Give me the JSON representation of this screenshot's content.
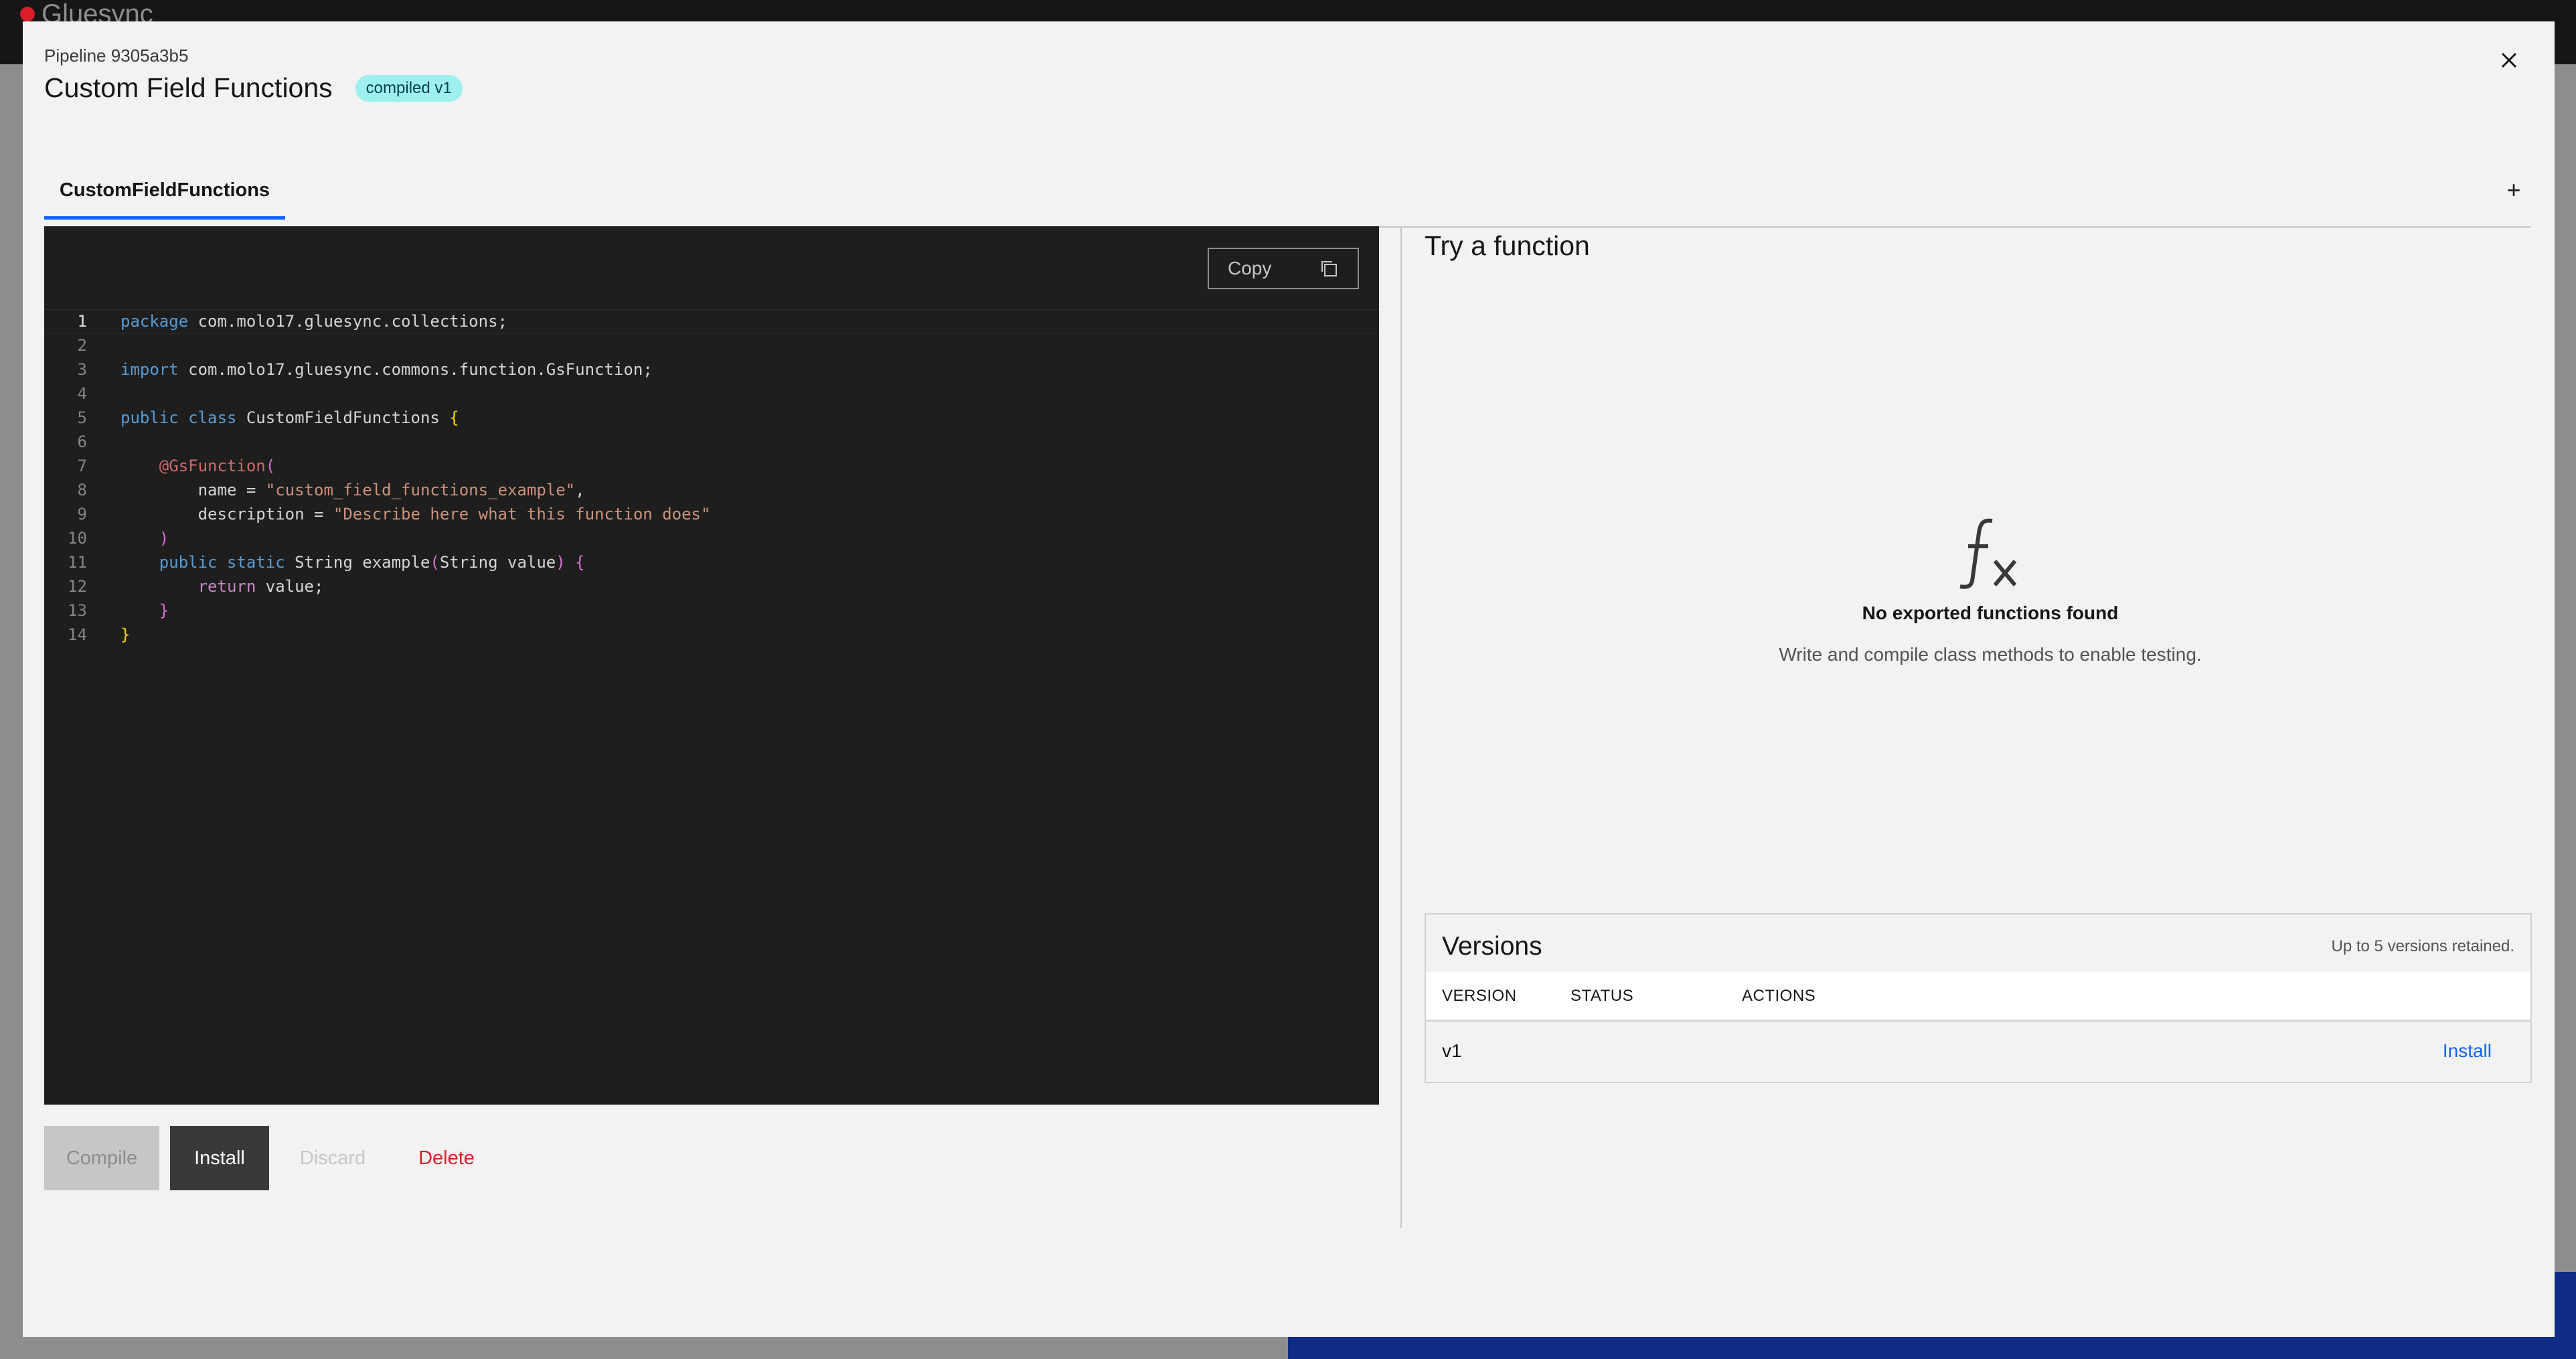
{
  "background": {
    "app_name": "Gluesync"
  },
  "modal": {
    "label": "Pipeline 9305a3b5",
    "title": "Custom Field Functions",
    "badge": "compiled v1"
  },
  "tabs": [
    {
      "label": "CustomFieldFunctions",
      "active": true
    }
  ],
  "add_tab_label": "+",
  "editor": {
    "copy_label": "Copy",
    "active_line": 1,
    "line_numbers": [
      "1",
      "2",
      "3",
      "4",
      "5",
      "6",
      "7",
      "8",
      "9",
      "10",
      "11",
      "12",
      "13",
      "14"
    ]
  },
  "actions": {
    "compile": "Compile",
    "install": "Install",
    "discard": "Discard",
    "delete": "Delete"
  },
  "try_panel": {
    "title": "Try a function",
    "empty_title": "No exported functions found",
    "empty_desc": "Write and compile class methods to enable testing."
  },
  "versions": {
    "title": "Versions",
    "note": "Up to 5 versions retained.",
    "columns": [
      "VERSION",
      "STATUS",
      "ACTIONS"
    ],
    "rows": [
      {
        "version": "v1",
        "status": "",
        "action": "Install"
      }
    ]
  },
  "colors": {
    "accent": "#0f62fe",
    "danger": "#da1e28",
    "badge_bg": "#9ef0f0",
    "editor_bg": "#1e1e1e"
  }
}
